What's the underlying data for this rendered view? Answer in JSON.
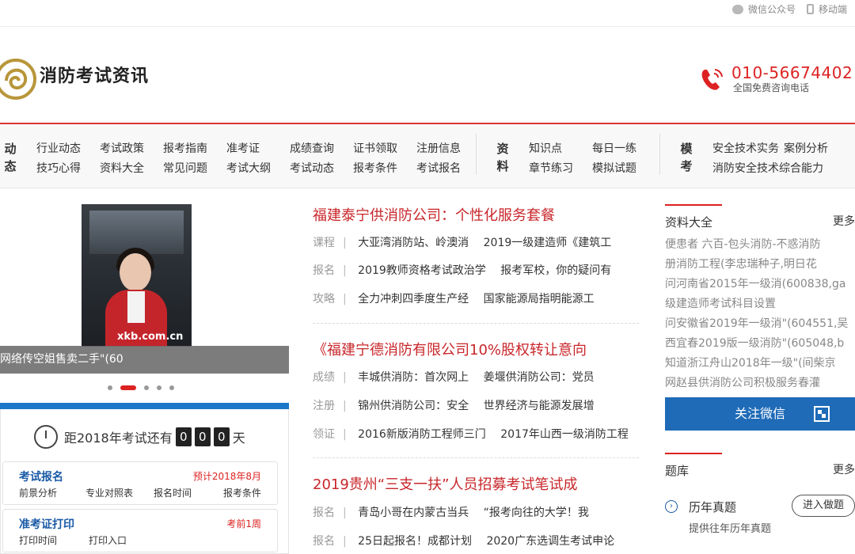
{
  "topbar": {
    "wechat": "微信公众号",
    "mobile": "移动端"
  },
  "header": {
    "brand": "消防考试资讯",
    "phone": "010-56674402",
    "phone_sub": "全国免费咨询电话"
  },
  "nav": {
    "groups": [
      {
        "title": [
          "动",
          "态"
        ],
        "links": [
          [
            "行业动态",
            "考试政策",
            "报考指南",
            "准考证",
            "成绩查询",
            "证书领取",
            "注册信息"
          ],
          [
            "技巧心得",
            "资料大全",
            "常见问题",
            "考试大纲",
            "考试动态",
            "报考条件",
            "考试报名"
          ]
        ]
      },
      {
        "title": [
          "资",
          "料"
        ],
        "links": [
          [
            "知识点",
            "每日一练"
          ],
          [
            "章节练习",
            "模拟试题"
          ]
        ]
      },
      {
        "title": [
          "模",
          "考"
        ],
        "links": [
          [
            "安全技术实务",
            "案例分析"
          ],
          [
            "消防安全技术综合能力"
          ]
        ]
      }
    ]
  },
  "slider": {
    "watermark": "xkb.com.cn",
    "caption": "网络传空姐售卖二手\"(60",
    "dots": 5,
    "active_dot": 1
  },
  "countdown": {
    "prefix": "距2018年考试还有",
    "digits": [
      "0",
      "0",
      "0"
    ],
    "suffix": "天"
  },
  "cards": [
    {
      "title": "考试报名",
      "note": "预计2018年8月",
      "links": [
        "前景分析",
        "专业对照表",
        "报名时间",
        "报考条件"
      ]
    },
    {
      "title": "准考证打印",
      "note": "考前1周",
      "links": [
        "打印时间",
        "打印入口"
      ]
    }
  ],
  "articles": [
    {
      "title": "福建泰宁供消防公司：个性化服务套餐",
      "rows": [
        {
          "tag": "课程",
          "a": "大亚湾消防站、岭澳消",
          "b": "2019一级建造师《建筑工"
        },
        {
          "tag": "报名",
          "a": "2019教师资格考试政治学",
          "b": "报考军校，你的疑问有"
        },
        {
          "tag": "攻略",
          "a": "全力冲刺四季度生产经",
          "b": "国家能源局指明能源工"
        }
      ]
    },
    {
      "title": "《福建宁德消防有限公司10%股权转让意向",
      "rows": [
        {
          "tag": "成绩",
          "a": "丰城供消防：首次网上",
          "b": "姜堰供消防公司：党员"
        },
        {
          "tag": "注册",
          "a": "锦州供消防公司：安全",
          "b": "世界经济与能源发展增"
        },
        {
          "tag": "领证",
          "a": "2016新版消防工程师三门",
          "b": "2017年山西一级消防工程"
        }
      ]
    },
    {
      "title": "2019贵州“三支一扶”人员招募考试笔试成",
      "rows": [
        {
          "tag": "报名",
          "a": "青岛小哥在内蒙古当兵",
          "b": "“报考向往的大学！我"
        },
        {
          "tag": "报名",
          "a": "25日起报名！成都计划",
          "b": "2020广东选调生考试申论"
        }
      ]
    }
  ],
  "sidebar": {
    "materials_title": "资料大全",
    "more": "更多",
    "materials": [
      "便患者 六百-包头消防-不惑消防",
      "册消防工程(李忠瑞种子,明日花",
      "问河南省2015年一级消(600838,ga",
      "级建造师考试科目设置",
      "问安徽省2019年一级消\"(604551,吴",
      "西宜春2019版一级消防\"(605048,b",
      "知道浙江舟山2018年一级\"(间柴京",
      "网赵县供消防公司积极服务春灌"
    ],
    "follow_label": "关注微信",
    "bank_title": "题库",
    "bank_item": "历年真题",
    "bank_item_sub": "提供往年历年真题",
    "bank_button": "进入做题"
  },
  "colors": {
    "accent_red": "#d22",
    "title_red": "#c8262a",
    "brand_blue": "#1a77c9",
    "follow_blue": "#1f6bb8"
  }
}
